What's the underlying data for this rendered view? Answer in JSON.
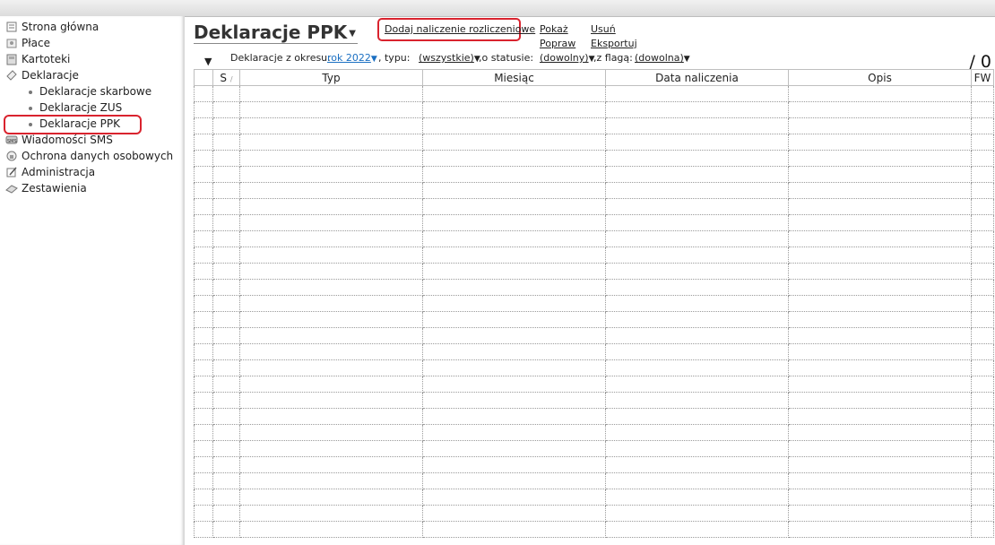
{
  "sidebar": {
    "items": [
      {
        "label": "Strona główna",
        "icon": "home-icon"
      },
      {
        "label": "Płace",
        "icon": "payroll-icon"
      },
      {
        "label": "Kartoteki",
        "icon": "records-icon"
      },
      {
        "label": "Deklaracje",
        "icon": "declarations-icon"
      },
      {
        "label": "Wiadomości SMS",
        "icon": "sms-icon"
      },
      {
        "label": "Ochrona danych osobowych",
        "icon": "data-protection-icon"
      },
      {
        "label": "Administracja",
        "icon": "admin-icon"
      },
      {
        "label": "Zestawienia",
        "icon": "reports-icon"
      }
    ],
    "sub": [
      "Deklaracje skarbowe",
      "Deklaracje ZUS",
      "Deklaracje PPK"
    ],
    "selected": "Deklaracje PPK"
  },
  "header": {
    "title": "Deklaracje PPK",
    "primary_action": "Dodaj naliczenie rozliczeniowe",
    "actions": {
      "show": "Pokaż",
      "edit": "Popraw",
      "delete": "Usuń",
      "export": "Eksportuj"
    }
  },
  "filters": {
    "period_label": "Deklaracje z okresu:",
    "period_value": "rok 2022",
    "type_label": ", typu:",
    "type_value": "(wszystkie)",
    "status_label": ",o statusie:",
    "status_value": "(dowolny)",
    "flag_label": ",z flagą:",
    "flag_value": "(dowolna)"
  },
  "record_count": "/ 0",
  "table": {
    "columns": [
      "S",
      "Typ",
      "Miesiąc",
      "Data naliczenia",
      "Opis",
      "FW"
    ],
    "empty_rows": 28
  },
  "colors": {
    "highlight": "#d9232e",
    "link_blue": "#1a6fc2"
  }
}
